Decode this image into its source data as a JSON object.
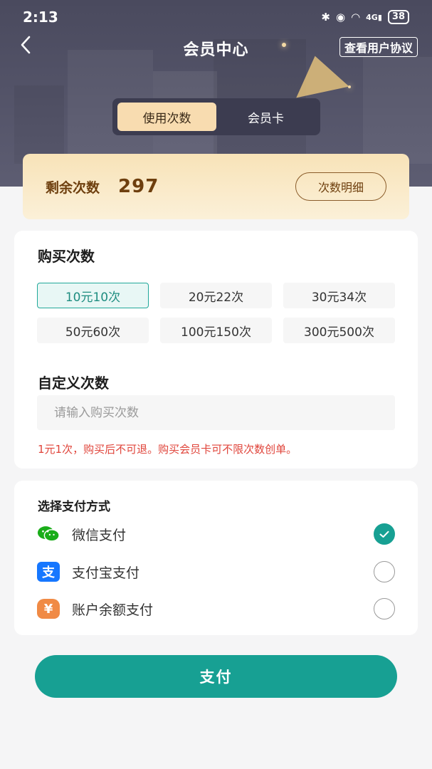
{
  "status_bar": {
    "time": "2:13",
    "network": "4G",
    "battery": "38"
  },
  "header": {
    "title": "会员中心",
    "back_icon": "chevron-left-icon",
    "agreement_label": "查看用户协议"
  },
  "tabs": [
    {
      "label": "使用次数",
      "active": true
    },
    {
      "label": "会员卡",
      "active": false
    }
  ],
  "remaining": {
    "label": "剩余次数",
    "count": "297",
    "detail_button": "次数明细"
  },
  "purchase": {
    "heading": "购买次数",
    "options": [
      {
        "label": "10元10次",
        "selected": true
      },
      {
        "label": "20元22次",
        "selected": false
      },
      {
        "label": "30元34次",
        "selected": false
      },
      {
        "label": "50元60次",
        "selected": false
      },
      {
        "label": "100元150次",
        "selected": false
      },
      {
        "label": "300元500次",
        "selected": false
      }
    ],
    "custom_heading": "自定义次数",
    "custom_placeholder": "请输入购买次数",
    "notice": "1元1次，购买后不可退。购买会员卡可不限次数创单。"
  },
  "payment": {
    "heading": "选择支付方式",
    "methods": [
      {
        "label": "微信支付",
        "icon": "wechat-pay-icon",
        "icon_glyph": "",
        "color": "#1aad19",
        "selected": true
      },
      {
        "label": "支付宝支付",
        "icon": "alipay-icon",
        "icon_glyph": "支",
        "color": "#1677ff",
        "selected": false
      },
      {
        "label": "账户余额支付",
        "icon": "wallet-icon",
        "icon_glyph": "¥",
        "color": "#f08a45",
        "selected": false
      }
    ]
  },
  "pay_button": "支付",
  "colors": {
    "accent": "#17a093",
    "gold_text": "#6e3f0e",
    "warning": "#e0453b"
  }
}
